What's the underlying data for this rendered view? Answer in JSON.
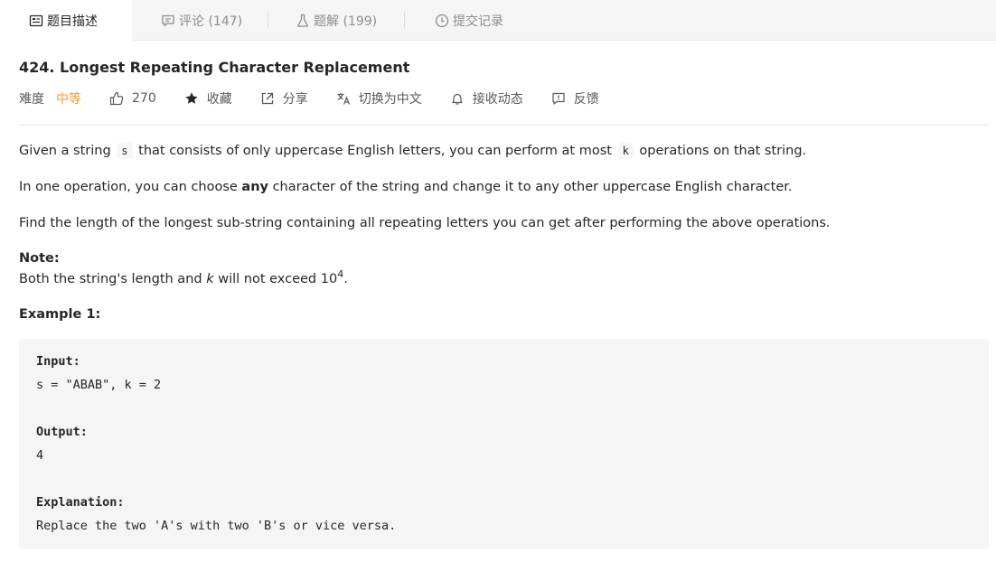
{
  "tabs": [
    {
      "label": "题目描述",
      "icon": "description-icon",
      "active": true
    },
    {
      "label": "评论 (147)",
      "icon": "comment-icon",
      "active": false
    },
    {
      "label": "题解 (199)",
      "icon": "flask-icon",
      "active": false
    },
    {
      "label": "提交记录",
      "icon": "clock-icon",
      "active": false
    }
  ],
  "problem": {
    "title": "424. Longest Repeating Character Replacement",
    "difficulty_label": "难度",
    "difficulty_value": "中等",
    "difficulty_color": "#ef9f3a",
    "likes": "270",
    "favorite_label": "收藏",
    "share_label": "分享",
    "translate_label": "切换为中文",
    "subscribe_label": "接收动态",
    "feedback_label": "反馈"
  },
  "description": {
    "p1_a": "Given a string",
    "p1_code1": "s",
    "p1_b": "that consists of only uppercase English letters, you can perform at most",
    "p1_code2": "k",
    "p1_c": "operations on that string.",
    "p2_a": "In one operation, you can choose",
    "p2_bold": "any",
    "p2_b": "character of the string and change it to any other uppercase English character.",
    "p3": "Find the length of the longest sub-string containing all repeating letters you can get after performing the above operations.",
    "note_label": "Note:",
    "note_a": "Both the string's length and",
    "note_k": "k",
    "note_b": "will not exceed 10",
    "note_sup": "4",
    "note_c": ".",
    "example_label": "Example 1:"
  },
  "example": {
    "input_label": "Input:",
    "input_value": "s = \"ABAB\", k = 2",
    "output_label": "Output:",
    "output_value": "4",
    "explanation_label": "Explanation:",
    "explanation_value": "Replace the two 'A's with two 'B's or vice versa."
  }
}
